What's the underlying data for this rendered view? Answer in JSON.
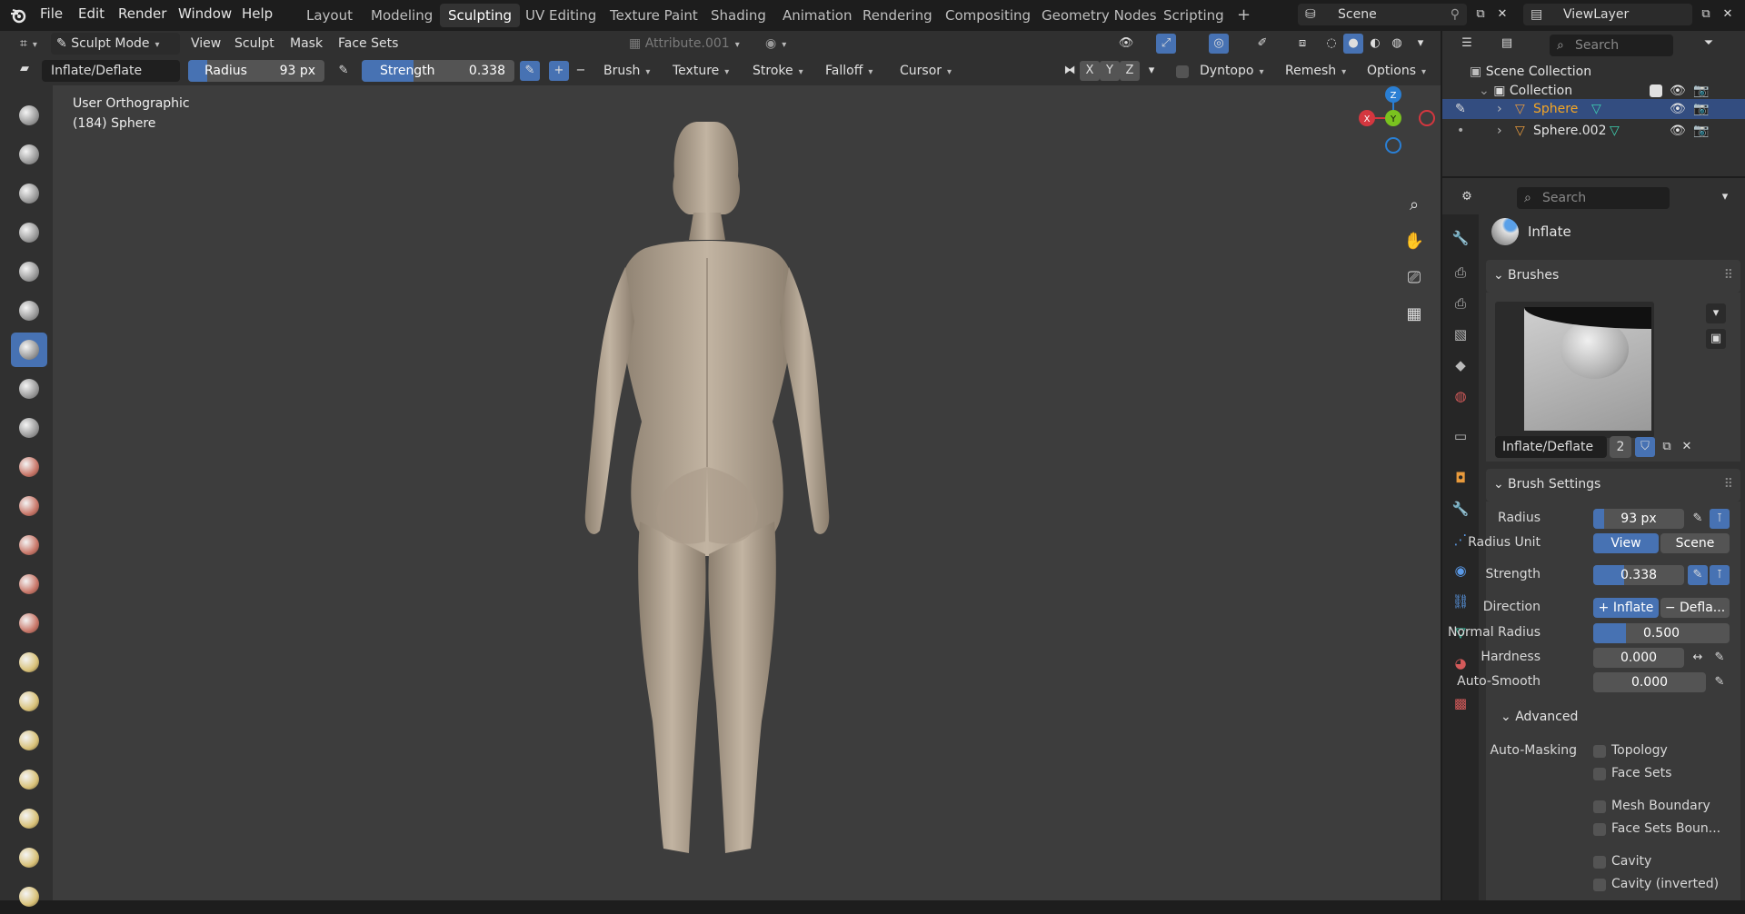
{
  "menubar": {
    "items": [
      "File",
      "Edit",
      "Render",
      "Window",
      "Help"
    ]
  },
  "workspace_tabs": {
    "items": [
      "Layout",
      "Modeling",
      "Sculpting",
      "UV Editing",
      "Texture Paint",
      "Shading",
      "Animation",
      "Rendering",
      "Compositing",
      "Geometry Nodes",
      "Scripting"
    ],
    "active": "Sculpting",
    "add": "+"
  },
  "scene": {
    "name": "Scene",
    "view_layer": "ViewLayer"
  },
  "header": {
    "mode": "Sculpt Mode",
    "menus": [
      "View",
      "Sculpt",
      "Mask",
      "Face Sets"
    ],
    "attribute": "Attribute.001",
    "brush_name": "Inflate/Deflate",
    "radius_label": "Radius",
    "radius_value": "93 px",
    "radius_fraction": 0.14,
    "strength_label": "Strength",
    "strength_value": "0.338",
    "strength_fraction": 0.338,
    "plus": "+",
    "minus": "−",
    "dropdowns": [
      "Brush",
      "Texture",
      "Stroke",
      "Falloff",
      "Cursor"
    ],
    "axes": [
      "X",
      "Y",
      "Z"
    ],
    "dyntopo": "Dyntopo",
    "remesh": "Remesh",
    "options": "Options"
  },
  "viewport": {
    "view_name": "User Orthographic",
    "object_info": "(184) Sphere",
    "gizmo": {
      "z": "Z",
      "y": "Y",
      "x": "X"
    }
  },
  "outliner": {
    "search_placeholder": "Search",
    "root": "Scene Collection",
    "collection": "Collection",
    "objects": [
      {
        "name": "Sphere",
        "selected": true
      },
      {
        "name": "Sphere.002",
        "selected": false
      }
    ]
  },
  "properties": {
    "search_placeholder": "Search",
    "tool_name": "Inflate",
    "brushes_section": "Brushes",
    "brush_datablock": "Inflate/Deflate",
    "brush_users": "2",
    "brush_settings_section": "Brush Settings",
    "radius_label": "Radius",
    "radius_value": "93 px",
    "radius_unit_label": "Radius Unit",
    "radius_unit_view": "View",
    "radius_unit_scene": "Scene",
    "strength_label": "Strength",
    "strength_value": "0.338",
    "direction_label": "Direction",
    "direction_inflate": "+ Inflate",
    "direction_deflate": "− Defla...",
    "normal_radius_label": "Normal Radius",
    "normal_radius_value": "0.500",
    "normal_radius_fraction": 0.5,
    "hardness_label": "Hardness",
    "hardness_value": "0.000",
    "autosmooth_label": "Auto-Smooth",
    "autosmooth_value": "0.000",
    "advanced_section": "Advanced",
    "automasking_label": "Auto-Masking",
    "automasking_options": [
      "Topology",
      "Face Sets",
      "Mesh Boundary",
      "Face Sets Boun...",
      "Cavity",
      "Cavity (inverted)"
    ]
  },
  "colors": {
    "accent": "#4772b3",
    "axis_x": "#d4373f",
    "axis_y": "#7ac21f",
    "axis_z": "#2a7fd4",
    "selected_text": "#f5a623"
  }
}
